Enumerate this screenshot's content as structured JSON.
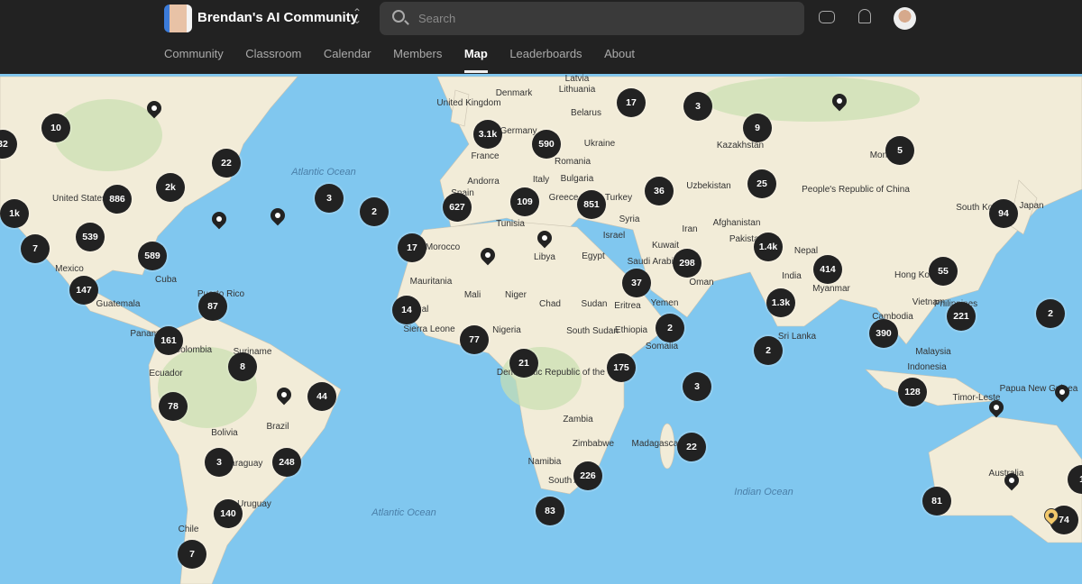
{
  "header": {
    "community_name": "Brendan's AI Community",
    "search_placeholder": "Search"
  },
  "nav": [
    "Community",
    "Classroom",
    "Calendar",
    "Members",
    "Map",
    "Leaderboards",
    "About"
  ],
  "active_tab": "Map",
  "clusters": [
    "32",
    "10",
    "22",
    "2k",
    "886",
    "1k",
    "539",
    "7",
    "589",
    "147",
    "87",
    "161",
    "8",
    "44",
    "78",
    "3",
    "248",
    "140",
    "7",
    "3",
    "2",
    "17",
    "14",
    "627",
    "3.1k",
    "590",
    "109",
    "851",
    "36",
    "17",
    "3",
    "9",
    "5",
    "25",
    "94",
    "1.4k",
    "298",
    "414",
    "55",
    "37",
    "1.3k",
    "221",
    "2",
    "2",
    "390",
    "2",
    "77",
    "21",
    "175",
    "3",
    "128",
    "22",
    "226",
    "83",
    "81",
    "74",
    "1"
  ],
  "map_labels": [
    "Denmark",
    "Latvia",
    "Lithuania",
    "United Kingdom",
    "Belarus",
    "Germany",
    "Ukraine",
    "France",
    "Romania",
    "Kazakhstan",
    "Bulgaria",
    "Andorra",
    "Italy",
    "Greece",
    "Turkey",
    "Uzbekistan",
    "People's Republic of China",
    "Spain",
    "Tunisia",
    "Syria",
    "Iran",
    "Afghanistan",
    "South Korea",
    "Japan",
    "Morocco",
    "Libya",
    "Egypt",
    "Israel",
    "Kuwait",
    "Pakistan",
    "Nepal",
    "Saudi Arabia",
    "Oman",
    "India",
    "Mauritania",
    "Mali",
    "Niger",
    "Chad",
    "Sudan",
    "Eritrea",
    "Yemen",
    "Myanmar",
    "Hong Kong",
    "Vietnam",
    "Philippines",
    "Cambodia",
    "Senegal",
    "Sierra Leone",
    "Nigeria",
    "South Sudan",
    "Ethiopia",
    "Somalia",
    "Sri Lanka",
    "Malaysia",
    "Indonesia",
    "Democratic Republic of the Congo",
    "Papua New Guinea",
    "Timor-Leste",
    "Zambia",
    "Madagascar",
    "Zimbabwe",
    "Namibia",
    "South Africa",
    "Australia",
    "United States",
    "Mexico",
    "Cuba",
    "Puerto Rico",
    "Guatemala",
    "Panama",
    "Colombia",
    "Suriname",
    "Ecuador",
    "Brazil",
    "Bolivia",
    "Paraguay",
    "Uruguay",
    "Chile",
    "Mongolia",
    "Atlantic Ocean",
    "Atlantic Ocean",
    "Indian Ocean"
  ],
  "colors": {
    "water": "#80c7ef",
    "land": "#f2ecd8",
    "marker": "#222222",
    "highlight_pin": "#f3c96b"
  }
}
